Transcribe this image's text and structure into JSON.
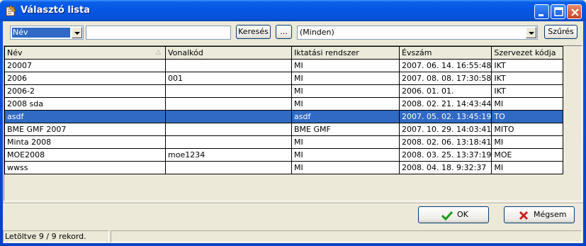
{
  "window": {
    "title": "Választó lista"
  },
  "toolbar": {
    "field_combo_value": "Név",
    "search_text": "",
    "search_button": "Keresés",
    "ellipsis_button": "...",
    "filter_combo_value": "(Minden)",
    "filter_button": "Szűrés"
  },
  "table": {
    "columns": [
      "Név",
      "Vonalkód",
      "Iktatási rendszer",
      "Évszám",
      "Szervezet kódja"
    ],
    "rows": [
      [
        "20007",
        "",
        "MI",
        "2007. 06. 14. 16:55:48",
        "IKT"
      ],
      [
        "2006",
        "001",
        "MI",
        "2007. 08. 08. 17:30:58",
        "IKT"
      ],
      [
        "2006-2",
        "",
        "MI",
        "2006. 01. 01.",
        "IKT"
      ],
      [
        "2008 sda",
        "",
        "MI",
        "2008. 02. 21. 14:43:44",
        "MI"
      ],
      [
        "asdf",
        "",
        "asdf",
        "2007. 05. 02. 13:45:19",
        "TO"
      ],
      [
        "BME GMF 2007",
        "",
        "BME GMF",
        "2007. 10. 29. 14:03:41",
        "MITO"
      ],
      [
        "Minta 2008",
        "",
        "MI",
        "2008. 02. 06. 13:18:41",
        "MI"
      ],
      [
        "MOE2008",
        "moe1234",
        "MI",
        "2008. 03. 25. 13:37:19",
        "MOE"
      ],
      [
        "wwss",
        "",
        "MI",
        "2008. 04. 18. 9:32:37",
        "MI"
      ]
    ],
    "selected_row": 4
  },
  "buttons": {
    "ok": "OK",
    "cancel": "Mégsem"
  },
  "status": {
    "text": "Letöltve 9 / 9 rekord.",
    "text2": ""
  },
  "colors": {
    "selection": "#316ac5",
    "titlebar": "#0655e3"
  }
}
